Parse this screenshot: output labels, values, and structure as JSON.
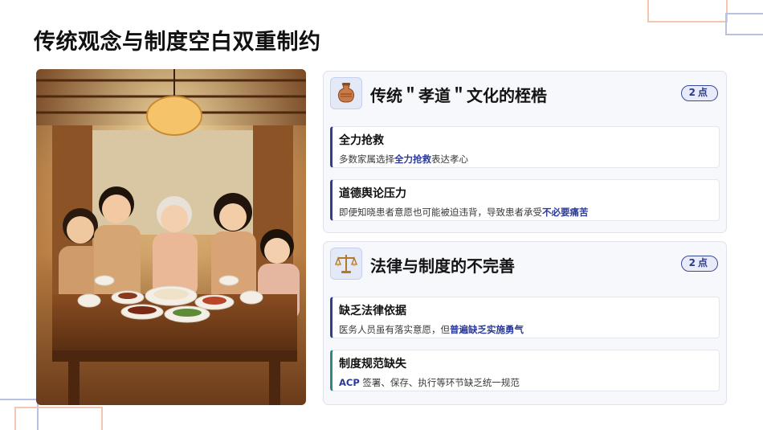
{
  "page": {
    "title": "传统观念与制度空白双重制约"
  },
  "colors": {
    "accent": "#2f3f8f",
    "teal": "#2a8a8a",
    "card_bg": "#f7f8fb"
  },
  "card1": {
    "icon": "vase-icon",
    "title": "传统＂孝道＂文化的桎梏",
    "badge_num": "2",
    "badge_unit": "点",
    "items": [
      {
        "title": "全力抢救",
        "desc_pre": "多数家属选择",
        "desc_hl": "全力抢救",
        "desc_post": "表达孝心"
      },
      {
        "title": "道德舆论压力",
        "desc_pre": "即便知晓患者意愿也可能被迫违背，导致患者承受",
        "desc_hl": "不必要痛苦",
        "desc_post": ""
      }
    ]
  },
  "card2": {
    "icon": "scales-icon",
    "title": "法律与制度的不完善",
    "badge_num": "2",
    "badge_unit": "点",
    "items": [
      {
        "title": "缺乏法律依据",
        "desc_pre": "医务人员虽有落实意愿，但",
        "desc_hl": "普遍缺乏实施勇气",
        "desc_post": ""
      },
      {
        "title": "制度规范缺失",
        "desc_pre": "",
        "desc_hl": "ACP",
        "desc_post": " 签署、保存、执行等环节缺乏统一规范"
      }
    ]
  }
}
